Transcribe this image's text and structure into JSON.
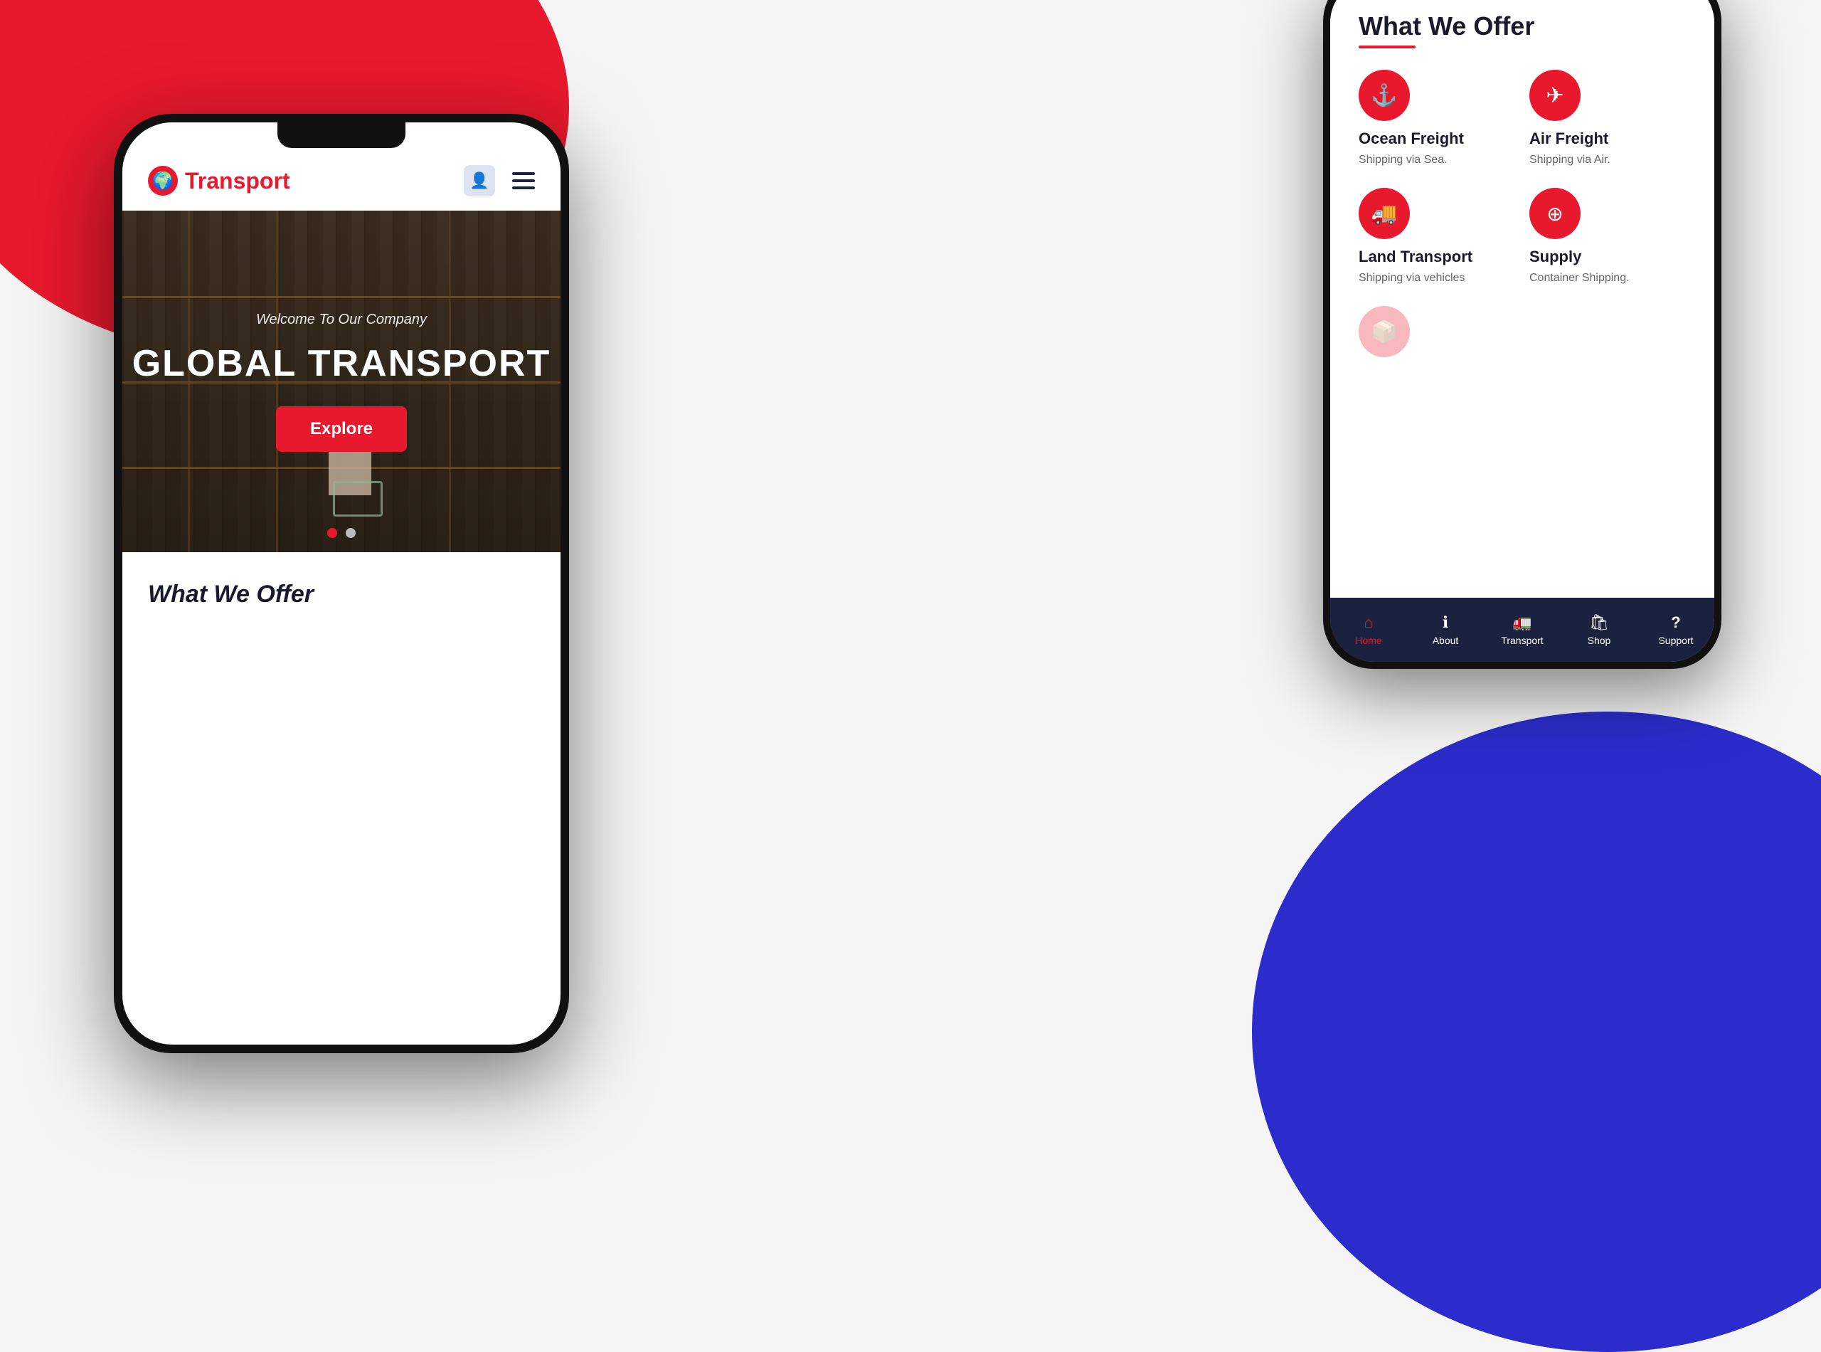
{
  "background": {
    "red_circle_desc": "decorative red circle top left",
    "blue_circle_desc": "decorative blue circle bottom right"
  },
  "phone_left": {
    "logo_text": "Transport",
    "logo_icon": "🌍",
    "hero": {
      "subtitle": "Welcome To Our Company",
      "title": "GLOBAL TRANSPORT",
      "explore_btn": "Explore",
      "dot1_active": true,
      "dot2_active": false
    },
    "section": {
      "title": "What We Offer"
    }
  },
  "phone_right": {
    "section_title": "What We Offer",
    "services": [
      {
        "icon": "⚓",
        "name": "Ocean Freight",
        "desc": "Shipping via Sea."
      },
      {
        "icon": "✈",
        "name": "Air Freight",
        "desc": "Shipping via Air."
      },
      {
        "icon": "🚚",
        "name": "Land Transport",
        "desc": "Shipping via vehicles"
      },
      {
        "icon": "🔴",
        "name": "Supply",
        "desc": "Container Shipping."
      }
    ],
    "nav": [
      {
        "icon": "⌂",
        "label": "Home",
        "active": true
      },
      {
        "icon": "ℹ",
        "label": "About",
        "active": false
      },
      {
        "icon": "🚛",
        "label": "Transport",
        "active": false
      },
      {
        "icon": "🛍",
        "label": "Shop",
        "active": false
      },
      {
        "icon": "?",
        "label": "Support",
        "active": false
      }
    ]
  }
}
